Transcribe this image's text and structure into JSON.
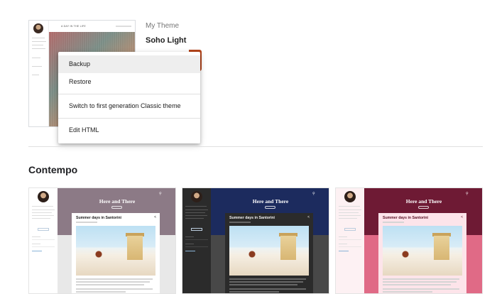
{
  "current": {
    "label": "My Theme",
    "name": "Soho Light",
    "thumb_title": "A DAY IN THE LIFE"
  },
  "menu": {
    "items": [
      "Backup",
      "Restore",
      "Switch to first generation Classic theme",
      "Edit HTML"
    ],
    "highlighted": "Backup"
  },
  "section": {
    "title": "Contempo"
  },
  "cards": [
    {
      "hero_title": "Here and There",
      "post_title": "Summer days in Santorini",
      "variant": "light",
      "sidebar_bg": "#ffffff",
      "hero_bg": "#8c7a86",
      "below_bg": "#e8e8e8",
      "post_bg": "#ffffff",
      "text_color": "#212121"
    },
    {
      "hero_title": "Here and There",
      "post_title": "Summer days in Santorini",
      "variant": "dark",
      "sidebar_bg": "#2b2b2b",
      "hero_bg": "#1c2b5e",
      "below_bg": "#484848",
      "post_bg": "#2b2b2b",
      "text_color": "#f1f1f1"
    },
    {
      "hero_title": "Here and There",
      "post_title": "Summer days in Santorini",
      "variant": "rose",
      "sidebar_bg": "#fdf1f3",
      "hero_bg": "#6e1a34",
      "below_bg": "#e06a86",
      "post_bg": "#fde4ea",
      "text_color": "#5a1024"
    }
  ],
  "colors": {
    "accent": "#b5451b",
    "menu_highlight": "#eeeeee",
    "divider": "#e0e0e0"
  },
  "icons": {
    "search": "search-icon",
    "share": "share-icon"
  }
}
